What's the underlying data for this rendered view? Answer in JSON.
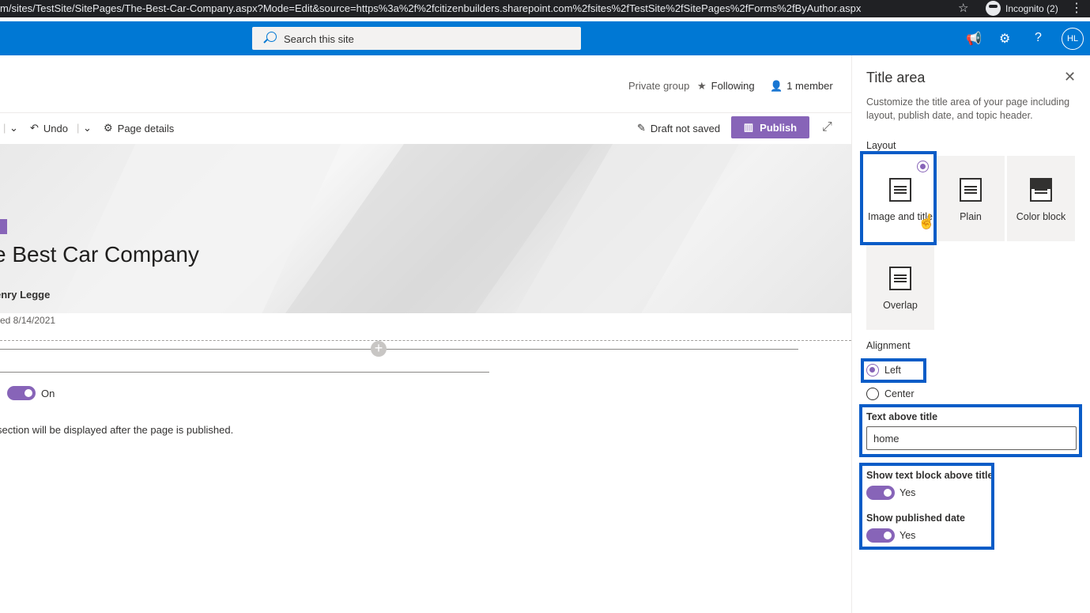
{
  "browser": {
    "url_main": "m/sites/TestSite/SitePages/The-Best-Car-Company.aspx?Mode=Edit&source=https%3a%2f%2fcitizenbuilders.sharepoint.com%2fsites%2fTestSite%2fSitePages%2fForms%2fByAuthor.aspx",
    "incognito_label": "Incognito (2)"
  },
  "suitebar": {
    "search_placeholder": "Search this site",
    "avatar_initials": "HL"
  },
  "site_header": {
    "group_type": "Private group",
    "following_label": "Following",
    "members_label": "1 member"
  },
  "command_bar": {
    "undo_label": "Undo",
    "page_details_label": "Page details",
    "draft_status": "Draft not saved",
    "publish_label": "Publish"
  },
  "page": {
    "title": "e Best Car Company",
    "author": "enry Legge",
    "saved_date": "ved 8/14/2021",
    "toggle_label": "On",
    "section_note": "section will be displayed after the page is published."
  },
  "panel": {
    "title": "Title area",
    "description": "Customize the title area of your page including layout, publish date, and topic header.",
    "layout_label": "Layout",
    "layouts": [
      {
        "label": "Image and title",
        "selected": true
      },
      {
        "label": "Plain",
        "selected": false
      },
      {
        "label": "Color block",
        "selected": false
      },
      {
        "label": "Overlap",
        "selected": false
      }
    ],
    "alignment_label": "Alignment",
    "alignment_options": [
      {
        "label": "Left",
        "selected": true
      },
      {
        "label": "Center",
        "selected": false
      }
    ],
    "text_above_title_label": "Text above title",
    "text_above_title_value": "home",
    "show_text_block_label": "Show text block above title",
    "show_text_block_value": "Yes",
    "show_published_date_label": "Show published date",
    "show_published_date_value": "Yes"
  },
  "colors": {
    "suite_blue": "#0078d4",
    "accent_purple": "#8764b8",
    "highlight_blue": "#0a5cc7"
  },
  "icons": [
    "search-icon",
    "star-icon",
    "person-icon",
    "undo-icon",
    "chevron-down-icon",
    "gear-icon",
    "pencil-icon",
    "book-icon",
    "expand-icon",
    "close-icon",
    "megaphone-icon",
    "help-icon"
  ]
}
